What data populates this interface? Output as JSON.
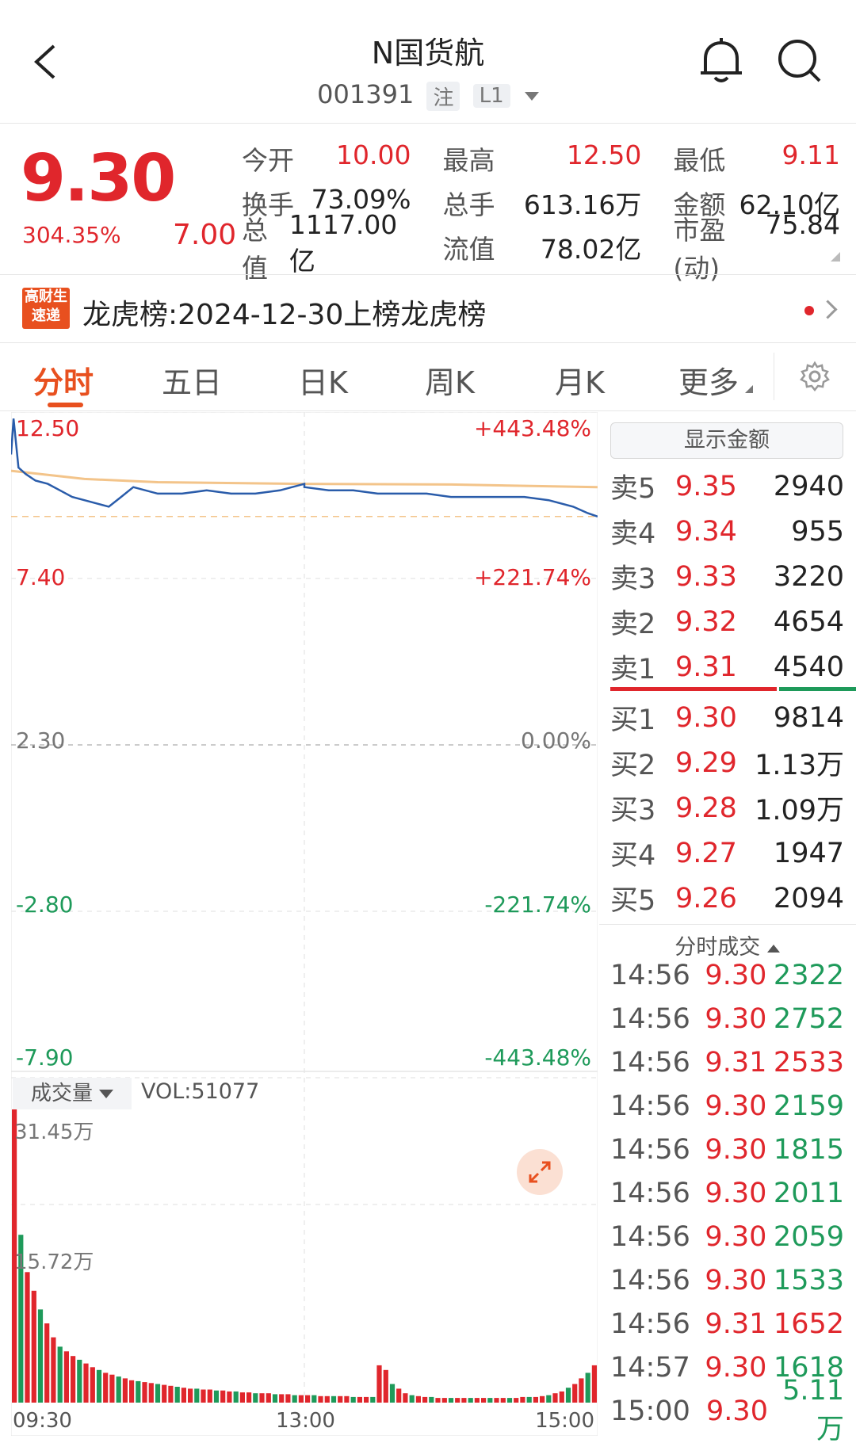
{
  "header": {
    "title": "N国货航",
    "code": "001391",
    "tag1": "注",
    "tag2": "L1"
  },
  "quote": {
    "price": "9.30",
    "change_pct": "304.35%",
    "change": "7.00",
    "stats": [
      [
        {
          "k": "今开",
          "v": "10.00",
          "c": "red"
        },
        {
          "k": "最高",
          "v": "12.50",
          "c": "red"
        },
        {
          "k": "最低",
          "v": "9.11",
          "c": "red"
        }
      ],
      [
        {
          "k": "换手",
          "v": "73.09%",
          "c": "dark"
        },
        {
          "k": "总手",
          "v": "613.16万",
          "c": "dark"
        },
        {
          "k": "金额",
          "v": "62.10亿",
          "c": "dark"
        }
      ],
      [
        {
          "k": "总值",
          "v": "1117.00亿",
          "c": "dark"
        },
        {
          "k": "流值",
          "v": "78.02亿",
          "c": "dark"
        },
        {
          "k": "市盈(动)",
          "v": "75.84",
          "c": "dark"
        }
      ]
    ]
  },
  "news": {
    "icon_text_1": "高财生",
    "icon_text_2": "速递",
    "text": "龙虎榜:2024-12-30上榜龙虎榜"
  },
  "tabs": [
    "分时",
    "五日",
    "日K",
    "周K",
    "月K",
    "更多"
  ],
  "chart": {
    "y_left": [
      "12.50",
      "7.40",
      "2.30",
      "-2.80",
      "-7.90"
    ],
    "y_right": [
      "+443.48%",
      "+221.74%",
      "0.00%",
      "-221.74%",
      "-443.48%"
    ],
    "vol_label": "成交量",
    "vol_value": "VOL:51077",
    "vol_max": "31.45万",
    "vol_mid": "15.72万",
    "x_labels": [
      "09:30",
      "13:00",
      "15:00"
    ]
  },
  "chart_data": {
    "type": "line",
    "title": "",
    "series": [
      {
        "name": "",
        "x": [
          "09:30",
          "09:31",
          "09:33",
          "09:36",
          "09:40",
          "09:45",
          "09:50",
          "09:55",
          "10:00",
          "10:05",
          "10:10",
          "10:15",
          "10:20",
          "10:30",
          "10:40",
          "10:50",
          "11:00",
          "11:10",
          "11:20",
          "11:30",
          "13:00",
          "13:10",
          "13:20",
          "13:30",
          "13:40",
          "13:50",
          "14:00",
          "14:10",
          "14:20",
          "14:30",
          "14:40",
          "14:50",
          "14:56",
          "15:00"
        ],
        "values": [
          11.2,
          12.3,
          10.8,
          10.6,
          10.4,
          10.3,
          10.1,
          9.9,
          9.8,
          9.7,
          9.6,
          9.9,
          10.2,
          10.0,
          10.0,
          10.1,
          10.0,
          10.0,
          10.1,
          10.3,
          10.2,
          10.1,
          10.1,
          10.0,
          10.0,
          10.0,
          9.9,
          9.9,
          9.9,
          9.9,
          9.8,
          9.6,
          9.4,
          9.3
        ]
      },
      {
        "name": "",
        "x": [
          "09:30",
          "10:00",
          "10:30",
          "11:30",
          "13:00",
          "14:00",
          "15:00"
        ],
        "values": [
          10.7,
          10.45,
          10.35,
          10.3,
          10.3,
          10.28,
          10.2
        ]
      }
    ],
    "ylim": [
      -7.9,
      12.5
    ],
    "prev_close": 2.3,
    "ref_line": 9.3,
    "volume": {
      "max": "31.45万",
      "series": [
        31.45,
        18.0,
        14.0,
        12.0,
        10.0,
        8.5,
        7.0,
        6.0,
        5.5,
        5.0,
        4.6,
        4.2,
        3.8,
        3.5,
        3.2,
        3.0,
        2.8,
        2.6,
        2.4,
        2.3,
        2.2,
        2.1,
        2.0,
        1.9,
        1.8,
        1.7,
        1.6,
        1.5,
        1.5,
        1.4,
        1.4,
        1.3,
        1.3,
        1.2,
        1.2,
        1.1,
        1.1,
        1.0,
        1.0,
        1.0,
        0.9,
        0.9,
        0.9,
        0.8,
        0.8,
        0.8,
        0.8,
        0.7,
        0.7,
        0.7,
        0.7,
        0.7,
        0.6,
        0.6,
        0.6,
        0.6,
        4.0,
        3.5,
        2.0,
        1.5,
        1.0,
        0.8,
        0.7,
        0.6,
        0.6,
        0.5,
        0.5,
        0.5,
        0.5,
        0.5,
        0.5,
        0.5,
        0.5,
        0.5,
        0.5,
        0.5,
        0.5,
        0.5,
        0.6,
        0.6,
        0.6,
        0.7,
        0.8,
        1.0,
        1.2,
        1.6,
        2.0,
        2.6,
        3.2,
        4.0
      ]
    }
  },
  "orderbook": {
    "show_amount": "显示金额",
    "asks": [
      {
        "label": "卖5",
        "price": "9.35",
        "vol": "2940"
      },
      {
        "label": "卖4",
        "price": "9.34",
        "vol": "955"
      },
      {
        "label": "卖3",
        "price": "9.33",
        "vol": "3220"
      },
      {
        "label": "卖2",
        "price": "9.32",
        "vol": "4654"
      },
      {
        "label": "卖1",
        "price": "9.31",
        "vol": "4540"
      }
    ],
    "bids": [
      {
        "label": "买1",
        "price": "9.30",
        "vol": "9814"
      },
      {
        "label": "买2",
        "price": "9.29",
        "vol": "1.13万"
      },
      {
        "label": "买3",
        "price": "9.28",
        "vol": "1.09万"
      },
      {
        "label": "买4",
        "price": "9.27",
        "vol": "1947"
      },
      {
        "label": "买5",
        "price": "9.26",
        "vol": "2094"
      }
    ]
  },
  "ticks": {
    "header": "分时成交",
    "rows": [
      {
        "t": "14:56",
        "p": "9.30",
        "v": "2322",
        "pc": "red",
        "vc": "green"
      },
      {
        "t": "14:56",
        "p": "9.30",
        "v": "2752",
        "pc": "red",
        "vc": "green"
      },
      {
        "t": "14:56",
        "p": "9.31",
        "v": "2533",
        "pc": "red",
        "vc": "red"
      },
      {
        "t": "14:56",
        "p": "9.30",
        "v": "2159",
        "pc": "red",
        "vc": "green"
      },
      {
        "t": "14:56",
        "p": "9.30",
        "v": "1815",
        "pc": "red",
        "vc": "green"
      },
      {
        "t": "14:56",
        "p": "9.30",
        "v": "2011",
        "pc": "red",
        "vc": "green"
      },
      {
        "t": "14:56",
        "p": "9.30",
        "v": "2059",
        "pc": "red",
        "vc": "green"
      },
      {
        "t": "14:56",
        "p": "9.30",
        "v": "1533",
        "pc": "red",
        "vc": "green"
      },
      {
        "t": "14:56",
        "p": "9.31",
        "v": "1652",
        "pc": "red",
        "vc": "red"
      },
      {
        "t": "14:57",
        "p": "9.30",
        "v": "1618",
        "pc": "red",
        "vc": "green"
      },
      {
        "t": "15:00",
        "p": "9.30",
        "v": "5.11万",
        "pc": "red",
        "vc": "green"
      }
    ]
  },
  "colors": {
    "up": "#e0262c",
    "down": "#1e9a5a",
    "accent": "#e8501f",
    "avg": "#f3c48a",
    "line": "#2a5caa"
  }
}
